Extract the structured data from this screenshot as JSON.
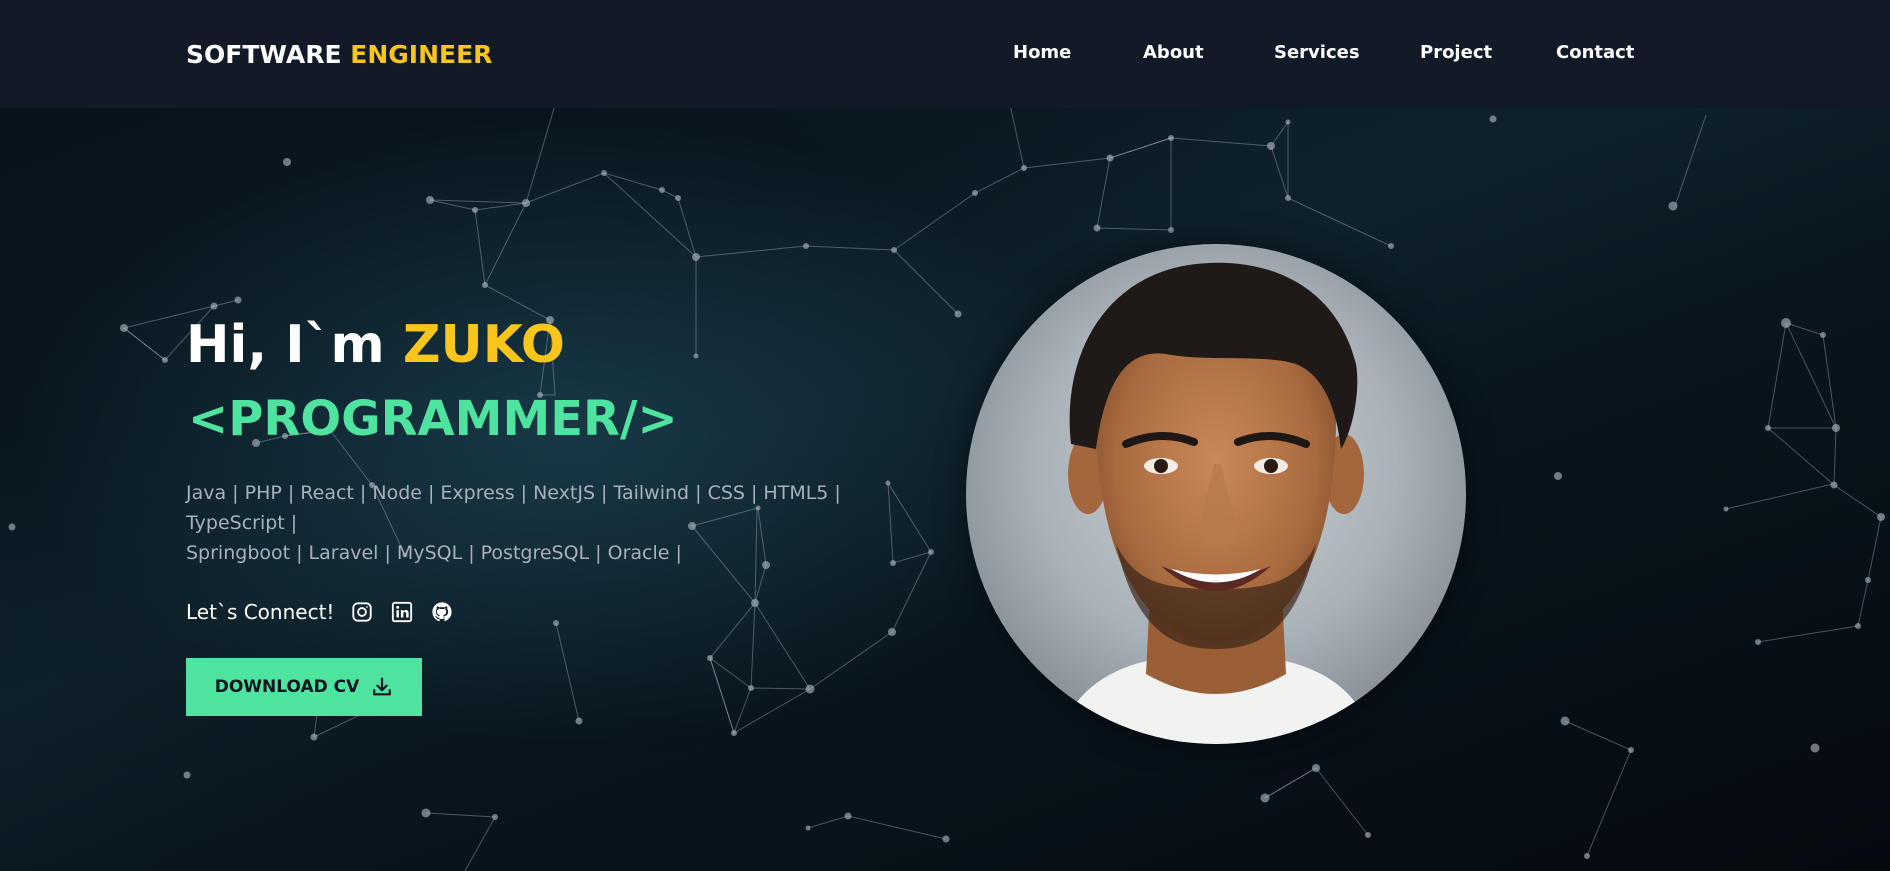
{
  "navbar": {
    "brand_part1": "SOFTWARE",
    "brand_part2": "ENGINEER",
    "links": [
      "Home",
      "About",
      "Services",
      "Project",
      "Contact"
    ]
  },
  "hero": {
    "greeting": "Hi, I`m ",
    "name": "ZUKO",
    "role": "<PROGRAMMER/>",
    "skills_line1": "Java | PHP | React | Node | Express | NextJS | Tailwind | CSS | HTML5 | TypeScript |",
    "skills_line2": "Springboot | Laravel | MySQL | PostgreSQL | Oracle |",
    "connect_label": "Let`s Connect!",
    "social_icons": [
      "instagram-icon",
      "linkedin-icon",
      "github-icon"
    ],
    "cv_button": "DOWNLOAD CV"
  },
  "colors": {
    "accent_yellow": "#f8c51c",
    "accent_green": "#4ee4a0",
    "navbar_bg": "#121a28",
    "page_bg": "#05080c"
  }
}
